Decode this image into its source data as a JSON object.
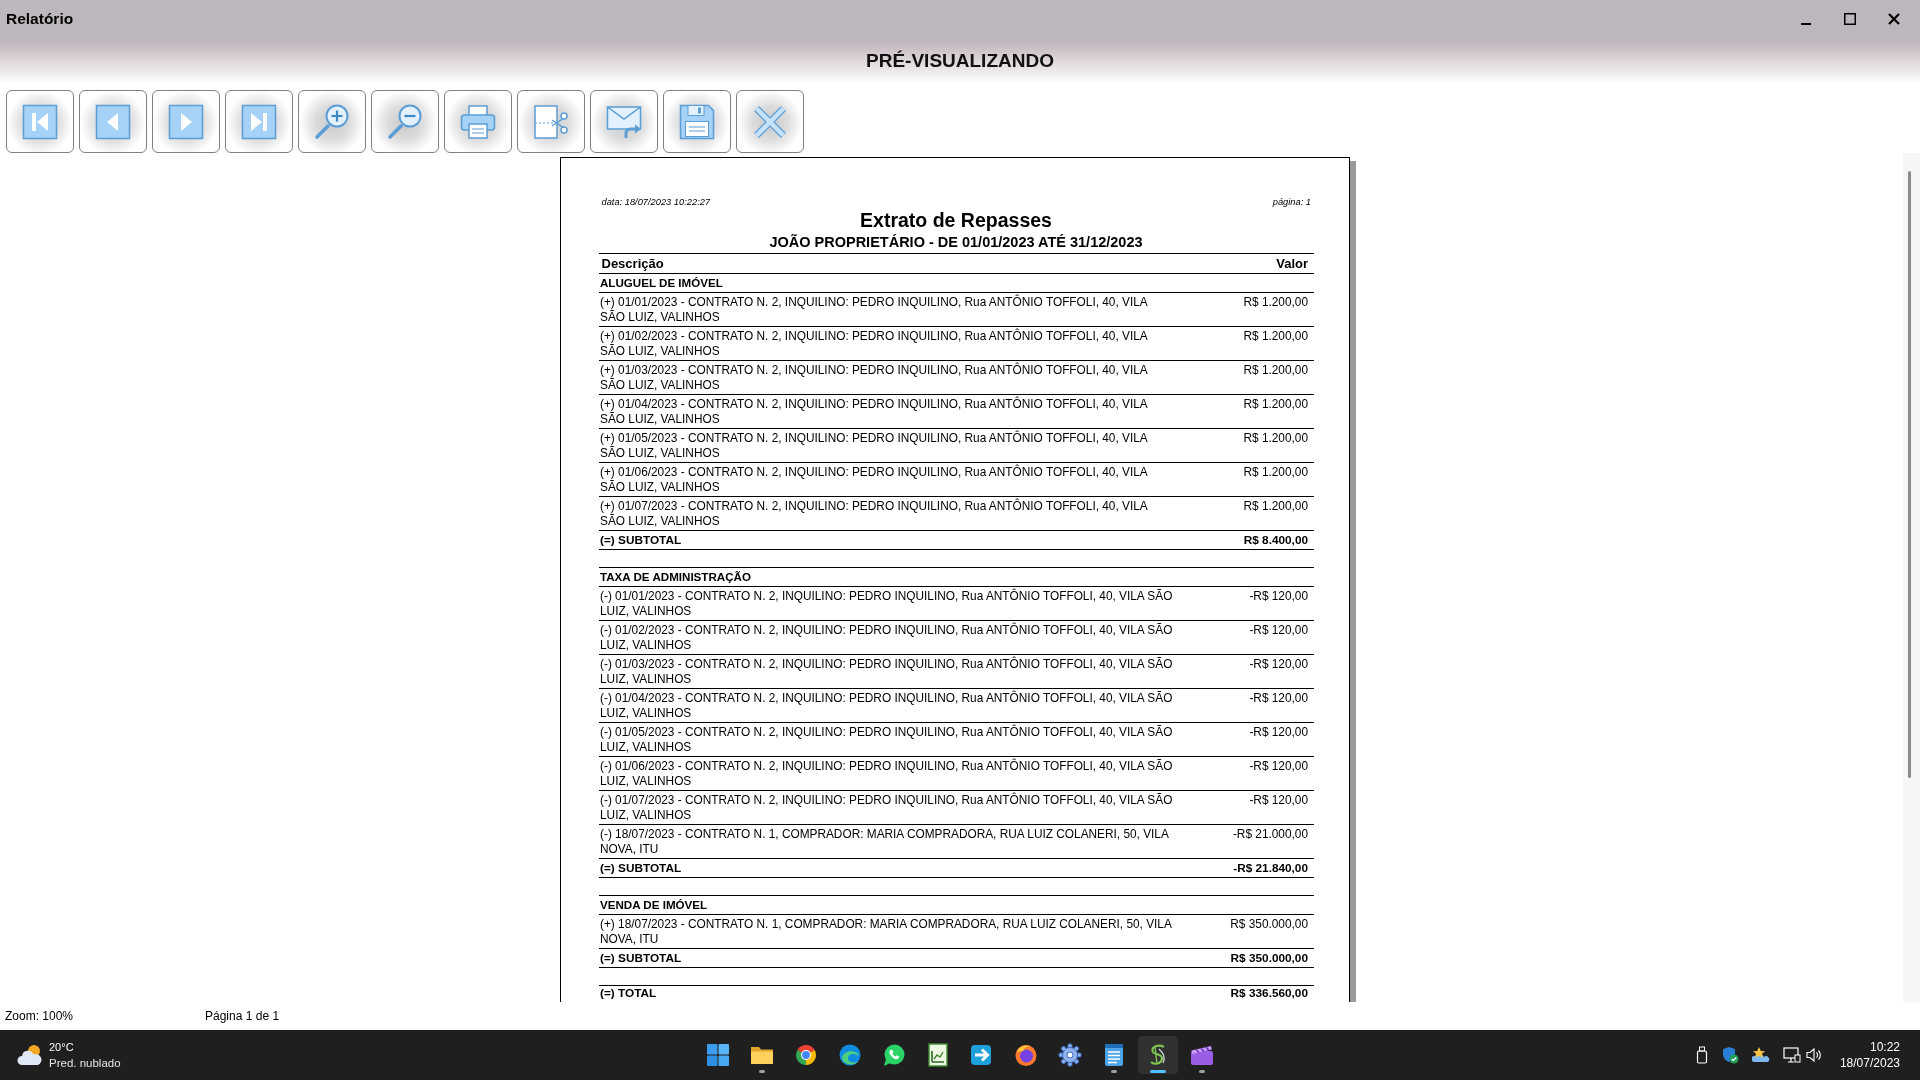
{
  "window": {
    "title": "Relatório",
    "heading": "PRÉ-VISUALIZANDO"
  },
  "report": {
    "date": "data: 18/07/2023 10:22:27",
    "page": "página: 1",
    "title": "Extrato de Repasses",
    "subtitle": "JOÃO PROPRIETÁRIO - DE 01/01/2023 ATÉ 31/12/2023",
    "columns": [
      "Descrição",
      "Valor"
    ],
    "sections": [
      {
        "title": "ALUGUEL DE IMÓVEL",
        "rows": [
          {
            "description": "(+) 01/01/2023 - CONTRATO N. 2, INQUILINO: PEDRO INQUILINO, Rua ANTÔNIO TOFFOLI, 40, VILA\nSÃO LUIZ, VALINHOS",
            "value": "R$ 1.200,00"
          },
          {
            "description": "(+) 01/02/2023 - CONTRATO N. 2, INQUILINO: PEDRO INQUILINO, Rua ANTÔNIO TOFFOLI, 40, VILA\nSÃO LUIZ, VALINHOS",
            "value": "R$ 1.200,00"
          },
          {
            "description": "(+) 01/03/2023 - CONTRATO N. 2, INQUILINO: PEDRO INQUILINO, Rua ANTÔNIO TOFFOLI, 40, VILA\nSÃO LUIZ, VALINHOS",
            "value": "R$ 1.200,00"
          },
          {
            "description": "(+) 01/04/2023 - CONTRATO N. 2, INQUILINO: PEDRO INQUILINO, Rua ANTÔNIO TOFFOLI, 40, VILA\nSÃO LUIZ, VALINHOS",
            "value": "R$ 1.200,00"
          },
          {
            "description": "(+) 01/05/2023 - CONTRATO N. 2, INQUILINO: PEDRO INQUILINO, Rua ANTÔNIO TOFFOLI, 40, VILA\nSÃO LUIZ, VALINHOS",
            "value": "R$ 1.200,00"
          },
          {
            "description": "(+) 01/06/2023 - CONTRATO N. 2, INQUILINO: PEDRO INQUILINO, Rua ANTÔNIO TOFFOLI, 40, VILA\nSÃO LUIZ, VALINHOS",
            "value": "R$ 1.200,00"
          },
          {
            "description": "(+) 01/07/2023 - CONTRATO N. 2, INQUILINO: PEDRO INQUILINO, Rua ANTÔNIO TOFFOLI, 40, VILA\nSÃO LUIZ, VALINHOS",
            "value": "R$ 1.200,00"
          }
        ],
        "subtotal": {
          "label": "(=) SUBTOTAL",
          "value": "R$ 8.400,00"
        }
      },
      {
        "title": "TAXA DE ADMINISTRAÇÃO",
        "rows": [
          {
            "description": "(-) 01/01/2023 - CONTRATO N. 2, INQUILINO: PEDRO INQUILINO, Rua ANTÔNIO TOFFOLI, 40, VILA SÃO\nLUIZ, VALINHOS",
            "value": "-R$ 120,00"
          },
          {
            "description": "(-) 01/02/2023 - CONTRATO N. 2, INQUILINO: PEDRO INQUILINO, Rua ANTÔNIO TOFFOLI, 40, VILA SÃO\nLUIZ, VALINHOS",
            "value": "-R$ 120,00"
          },
          {
            "description": "(-) 01/03/2023 - CONTRATO N. 2, INQUILINO: PEDRO INQUILINO, Rua ANTÔNIO TOFFOLI, 40, VILA SÃO\nLUIZ, VALINHOS",
            "value": "-R$ 120,00"
          },
          {
            "description": "(-) 01/04/2023 - CONTRATO N. 2, INQUILINO: PEDRO INQUILINO, Rua ANTÔNIO TOFFOLI, 40, VILA SÃO\nLUIZ, VALINHOS",
            "value": "-R$ 120,00"
          },
          {
            "description": "(-) 01/05/2023 - CONTRATO N. 2, INQUILINO: PEDRO INQUILINO, Rua ANTÔNIO TOFFOLI, 40, VILA SÃO\nLUIZ, VALINHOS",
            "value": "-R$ 120,00"
          },
          {
            "description": "(-) 01/06/2023 - CONTRATO N. 2, INQUILINO: PEDRO INQUILINO, Rua ANTÔNIO TOFFOLI, 40, VILA SÃO\nLUIZ, VALINHOS",
            "value": "-R$ 120,00"
          },
          {
            "description": "(-) 01/07/2023 - CONTRATO N. 2, INQUILINO: PEDRO INQUILINO, Rua ANTÔNIO TOFFOLI, 40, VILA SÃO\nLUIZ, VALINHOS",
            "value": "-R$ 120,00"
          },
          {
            "description": "(-) 18/07/2023 - CONTRATO N. 1, COMPRADOR: MARIA COMPRADORA, RUA LUIZ COLANERI, 50, VILA\nNOVA, ITU",
            "value": "-R$ 21.000,00"
          }
        ],
        "subtotal": {
          "label": "(=) SUBTOTAL",
          "value": "-R$ 21.840,00"
        }
      },
      {
        "title": "VENDA DE IMÓVEL",
        "rows": [
          {
            "description": "(+) 18/07/2023 - CONTRATO N. 1, COMPRADOR: MARIA COMPRADORA, RUA LUIZ COLANERI, 50, VILA\nNOVA, ITU",
            "value": "R$ 350.000,00"
          }
        ],
        "subtotal": {
          "label": "(=) SUBTOTAL",
          "value": "R$ 350.000,00"
        }
      }
    ],
    "total": {
      "label": "(=) TOTAL",
      "value": "R$ 336.560,00"
    }
  },
  "status_bar": {
    "zoom": "Zoom: 100%",
    "page": "Página 1 de 1"
  },
  "taskbar": {
    "weather": {
      "temperature": "20°C",
      "condition": "Pred. nublado"
    },
    "apps": [
      {
        "kind": "start",
        "running": false,
        "selected": false
      },
      {
        "kind": "folder",
        "running": true,
        "selected": false
      },
      {
        "kind": "ring",
        "running": false,
        "selected": false
      },
      {
        "kind": "wave",
        "running": false,
        "selected": false
      },
      {
        "kind": "chat",
        "running": false,
        "selected": false
      },
      {
        "kind": "sheet",
        "running": false,
        "selected": false
      },
      {
        "kind": "arrowbox",
        "running": false,
        "selected": false
      },
      {
        "kind": "fox",
        "running": false,
        "selected": false
      },
      {
        "kind": "gear",
        "running": false,
        "selected": false
      },
      {
        "kind": "notepad",
        "running": true,
        "selected": false
      },
      {
        "kind": "swirl",
        "running": true,
        "selected": true
      },
      {
        "kind": "clapper",
        "running": true,
        "selected": false
      }
    ],
    "clock": {
      "time": "10:22",
      "date": "18/07/2023"
    }
  }
}
